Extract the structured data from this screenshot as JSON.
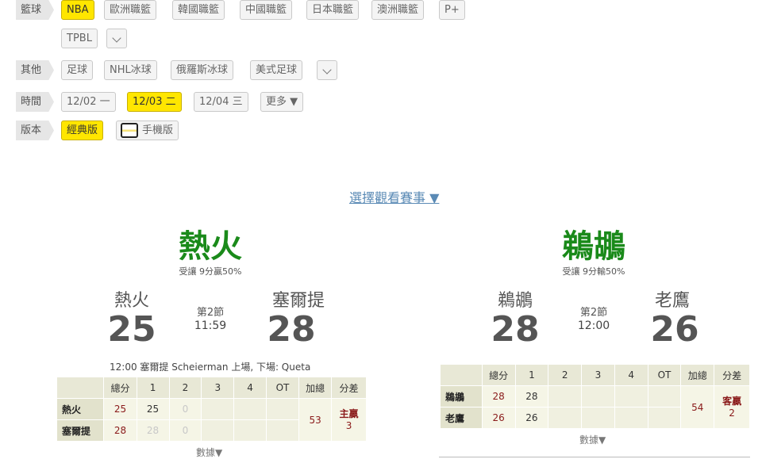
{
  "filters": {
    "basketball": {
      "label": "籃球",
      "items": [
        "NBA",
        "歐洲職籃",
        "韓國職籃",
        "中國職籃",
        "日本職籃",
        "澳洲職籃",
        "P+",
        "TPBL"
      ],
      "active": "NBA"
    },
    "other": {
      "label": "其他",
      "items": [
        "足球",
        "NHL冰球",
        "俄羅斯冰球",
        "美式足球"
      ]
    },
    "time": {
      "label": "時間",
      "items": [
        "12/02 一",
        "12/03 二",
        "12/04 三"
      ],
      "active": "12/03 二",
      "more": "更多 ▼"
    },
    "version": {
      "label": "版本",
      "classic": "經典版",
      "mobile": "手機版"
    }
  },
  "selector": "選擇觀看賽事 ▼",
  "games": [
    {
      "title": "熱火",
      "odds": "受讓 9分贏50%",
      "home_team": "熱火",
      "away_team": "塞爾提",
      "home_score": "25",
      "away_score": "28",
      "period": "第2節",
      "clock": "11:59",
      "event": "12:00 塞爾提 Scheierman 上場, 下場: Queta",
      "table": {
        "headers": [
          "總分",
          "1",
          "2",
          "3",
          "4",
          "OT",
          "加總",
          "分差"
        ],
        "rows": [
          {
            "team": "熱火",
            "total": "25",
            "q1": "25",
            "q2": "0"
          },
          {
            "team": "塞爾提",
            "total": "28",
            "q1": "28",
            "q2": "0"
          }
        ],
        "sum": "53",
        "diff_line1": "主贏",
        "diff_line2": "3"
      },
      "more": "數據▼"
    },
    {
      "title": "鵜鶘",
      "odds": "受讓 9分輸50%",
      "home_team": "鵜鶘",
      "away_team": "老鷹",
      "home_score": "28",
      "away_score": "26",
      "period": "第2節",
      "clock": "12:00",
      "table": {
        "headers": [
          "總分",
          "1",
          "2",
          "3",
          "4",
          "OT",
          "加總",
          "分差"
        ],
        "rows": [
          {
            "team": "鵜鶘",
            "total": "28",
            "q1": "28"
          },
          {
            "team": "老鷹",
            "total": "26",
            "q1": "26"
          }
        ],
        "sum": "54",
        "diff_line1": "客贏",
        "diff_line2": "2"
      },
      "more": "數據▼"
    }
  ],
  "colors": {
    "active": "#ffe600",
    "title_green": "#1a8a1a",
    "value_red": "#8a1a1a",
    "link_blue": "#5a8ab5"
  }
}
